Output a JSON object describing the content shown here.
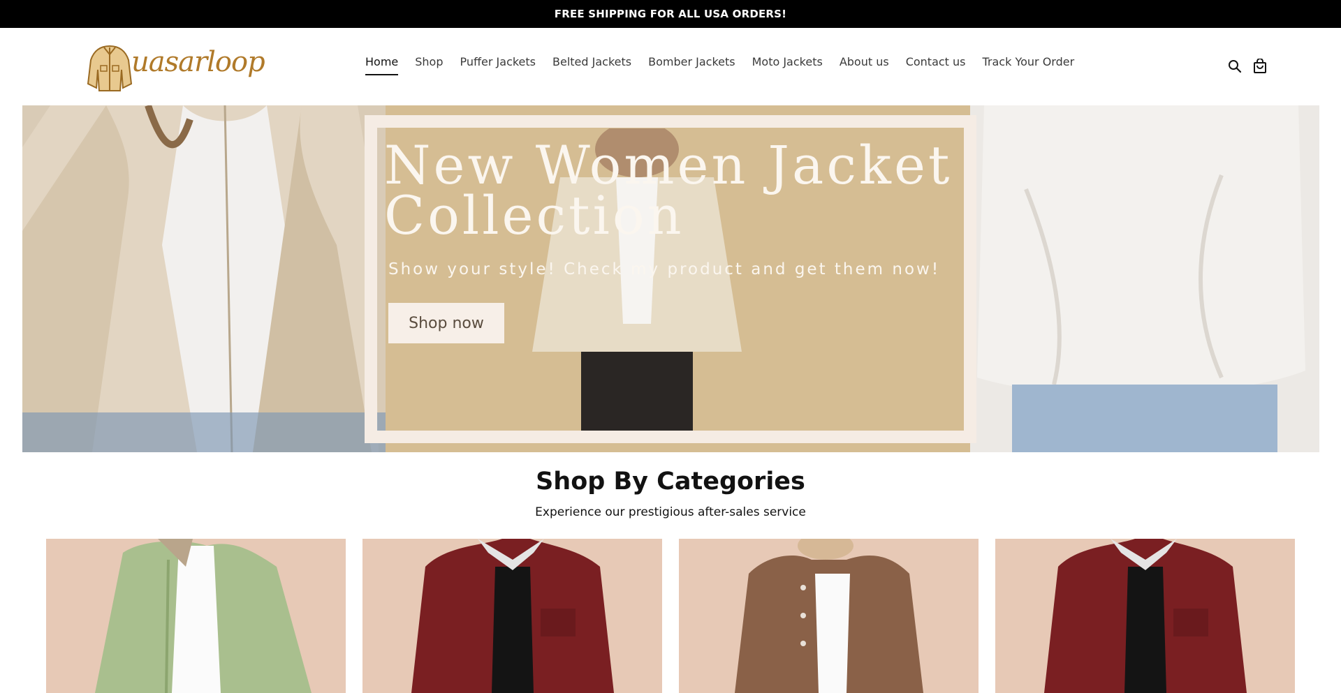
{
  "announcement": {
    "text": "FREE SHIPPING FOR ALL USA ORDERS!"
  },
  "header": {
    "logo_text": "uasarloop",
    "nav": [
      {
        "label": "Home",
        "active": true
      },
      {
        "label": "Shop",
        "active": false
      },
      {
        "label": "Puffer Jackets",
        "active": false
      },
      {
        "label": "Belted Jackets",
        "active": false
      },
      {
        "label": "Bomber Jackets",
        "active": false
      },
      {
        "label": "Moto Jackets",
        "active": false
      },
      {
        "label": "About us",
        "active": false
      },
      {
        "label": "Contact us",
        "active": false
      },
      {
        "label": "Track Your Order",
        "active": false
      }
    ],
    "icons": {
      "search": "search-icon",
      "cart": "shopping-bag-icon"
    }
  },
  "hero": {
    "title": "New Women Jacket Collection",
    "subtitle": "Show your style! Check my product and get them now!",
    "cta_label": "Shop now"
  },
  "categories": {
    "title": "Shop By Categories",
    "subtitle": "Experience our prestigious after-sales service"
  },
  "colors": {
    "announcement_bg": "#000000",
    "hero_bg": "#d5bd93",
    "hero_frame": "#f5ece4",
    "card_bg": "#e7c9b6",
    "logo": "#b07a2a"
  }
}
